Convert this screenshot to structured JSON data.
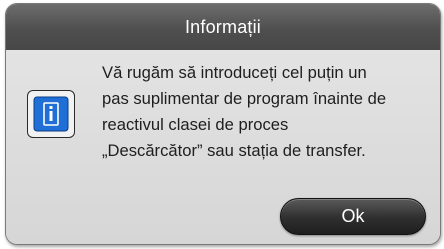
{
  "dialog": {
    "title": "Informații",
    "icon": "info-icon",
    "message_lines": [
      "Vă rugăm să introduceți cel puțin un",
      "pas suplimentar de program înainte de",
      "reactivul clasei de proces",
      "„Descărcător” sau stația de transfer."
    ],
    "ok_label": "Ok"
  },
  "colors": {
    "title_bar": "#555555",
    "dialog_bg": "#d9d9d9",
    "icon_blue": "#1f6fd6",
    "button_bg": "#2e2e2e"
  }
}
